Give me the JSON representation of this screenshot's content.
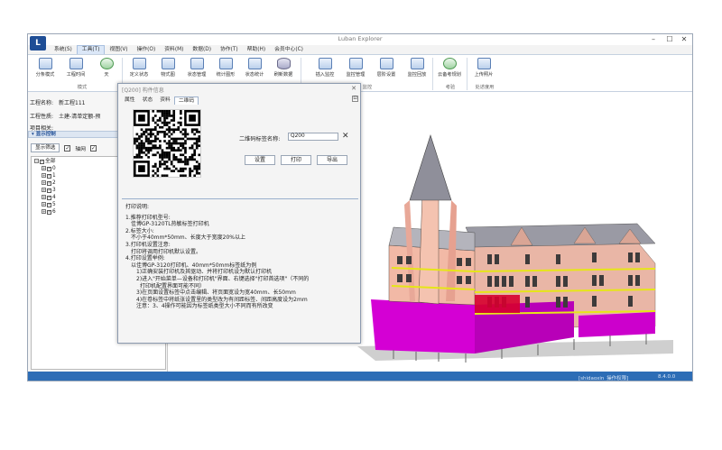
{
  "window": {
    "title": "Luban Explorer",
    "logo_letter": "L",
    "minimize": "–",
    "maximize": "☐",
    "close": "✕"
  },
  "menu": {
    "items": [
      {
        "label": "系统(S)"
      },
      {
        "label": "工具(T)"
      },
      {
        "label": "视图(V)"
      },
      {
        "label": "操作(O)"
      },
      {
        "label": "资料(M)"
      },
      {
        "label": "数据(D)"
      },
      {
        "label": "协作(T)"
      },
      {
        "label": "帮助(H)"
      },
      {
        "label": "会员中心(C)"
      }
    ],
    "active_index": 1
  },
  "ribbon": {
    "buttons": [
      {
        "label": "分条模式"
      },
      {
        "label": "工程时间"
      },
      {
        "label": "天"
      },
      {
        "label": "定义状态"
      },
      {
        "label": "物式图"
      },
      {
        "label": "状态管理"
      },
      {
        "label": "统计图形"
      },
      {
        "label": "状态统计"
      },
      {
        "label": "刷新数据"
      },
      {
        "label": "插入监控"
      },
      {
        "label": "监控管理"
      },
      {
        "label": "层阶设置"
      },
      {
        "label": "监控回放"
      },
      {
        "label": "云备考规划"
      },
      {
        "label": "上传照片"
      }
    ],
    "groups": [
      {
        "label": "模式"
      },
      {
        "label": "监控"
      },
      {
        "label": "考验"
      },
      {
        "label": "处述度用"
      }
    ]
  },
  "info": {
    "project_name_label": "工程名称:",
    "project_name_value": "新工程111",
    "project_type_label": "工程性质:",
    "project_type_value": "土建-清单定额-预",
    "project_related_label": "项目相关:"
  },
  "display_control": {
    "header": "显示控制",
    "filter_button": "显示筛选",
    "axis_label": "轴网",
    "axis_checked": true
  },
  "tree": {
    "root": "全部",
    "children": [
      "0",
      "1",
      "2",
      "3",
      "4",
      "5",
      "6"
    ]
  },
  "status": {
    "user": "[shidaoxin_操作权限]",
    "version": "8.4.0.0"
  },
  "dialog": {
    "title": "[Q200] 构件信息",
    "close": "✕",
    "pin": "⊡",
    "tabs": [
      {
        "label": "属性"
      },
      {
        "label": "状态"
      },
      {
        "label": "资料"
      },
      {
        "label": "二维码"
      }
    ],
    "active_tab": 3,
    "qr_label": "二维码标签名称:",
    "qr_value": "Q200",
    "clear_label": "✕",
    "buttons": {
      "settings": "设置",
      "print": "打印",
      "export": "导出"
    },
    "instructions": {
      "heading": "打印说明:",
      "lines": [
        {
          "text": "1.推荐打印机型号:",
          "indent": 0
        },
        {
          "text": "佳博GP-3120TL热敏标签打印机",
          "indent": 1
        },
        {
          "text": "2.标签大小:",
          "indent": 0
        },
        {
          "text": "不小于40mm*50mm、长度大于宽度20%以上",
          "indent": 1
        },
        {
          "text": "3.打印机设置注意:",
          "indent": 0
        },
        {
          "text": "打印将调用打印机默认设置。",
          "indent": 1
        },
        {
          "text": "4.打印设置举例:",
          "indent": 0
        },
        {
          "text": "以佳博GP-3120打印机、40mm*50mm标签纸为例",
          "indent": 1
        },
        {
          "text": "1)正确安装打印机及其驱动、并将打印机设为默认打印机",
          "indent": 2
        },
        {
          "text": "2)进入\"开始菜单—设备和打印机\"界面、右键选择\"打印首选项\"（不同的",
          "indent": 2
        },
        {
          "text": "打印机配置界面可能不同）",
          "indent": 3
        },
        {
          "text": "3)在页面设置标签中点击编辑、将页面宽设为宽40mm、长50mm",
          "indent": 2
        },
        {
          "text": "4)在卷标签中将纸张设置里的类型改为有间距标签、间距高度设为2mm",
          "indent": 2
        },
        {
          "text": "注意：3、4操作可能因为标签纸类型大小不同而有所改变",
          "indent": 2
        }
      ]
    }
  },
  "colors": {
    "accent": "#2d6db6",
    "status_bar": "#2d6db6",
    "building_magenta": "#d400d4",
    "building_pink": "#f0b7a8",
    "building_yellow": "#e6e617"
  }
}
